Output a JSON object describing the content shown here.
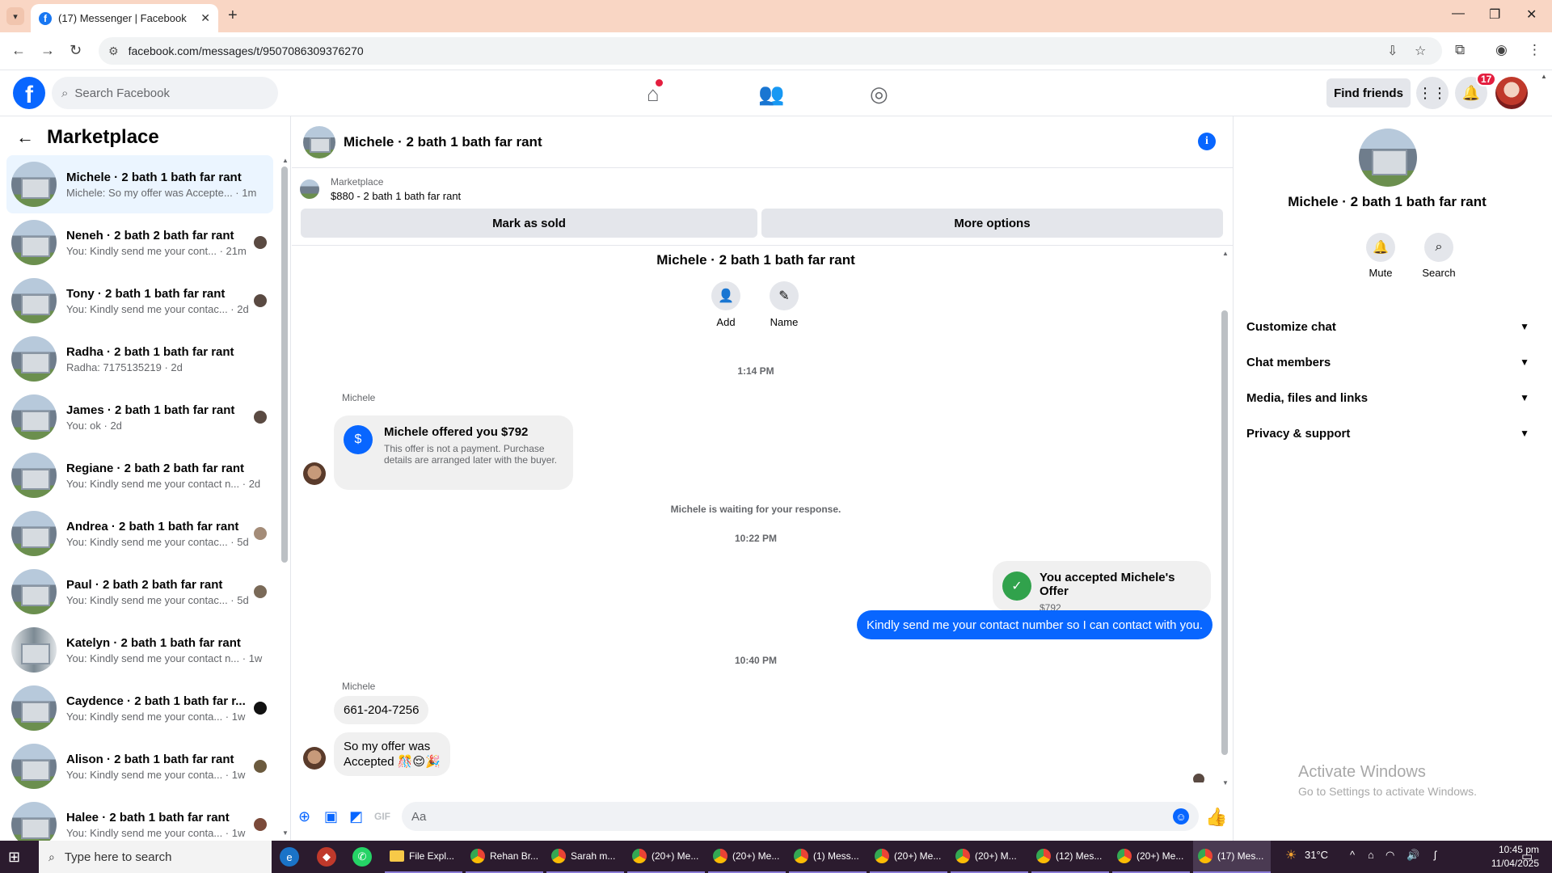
{
  "browser": {
    "tab_title": "(17) Messenger | Facebook",
    "url": "facebook.com/messages/t/9507086309376270"
  },
  "fb": {
    "search_placeholder": "Search Facebook",
    "find_friends": "Find friends",
    "notif_count": "17"
  },
  "sidebar": {
    "title": "Marketplace",
    "conversations": [
      {
        "name": "Michele · 2 bath 1 bath far rant",
        "preview": "Michele: So my offer was Accepte... · 1m",
        "active": true
      },
      {
        "name": "Neneh · 2 bath 2 bath far rant",
        "preview": "You: Kindly send me your cont... · 21m"
      },
      {
        "name": "Tony · 2 bath 1 bath far rant",
        "preview": "You: Kindly send me your contac... · 2d"
      },
      {
        "name": "Radha · 2 bath 1 bath far rant",
        "preview": "Radha: 7175135219 · 2d"
      },
      {
        "name": "James · 2 bath 1 bath far rant",
        "preview": "You: ok · 2d"
      },
      {
        "name": "Regiane · 2 bath 2 bath far rant",
        "preview": "You: Kindly send me your contact n... · 2d"
      },
      {
        "name": "Andrea · 2 bath 1 bath far rant",
        "preview": "You: Kindly send me your contac... · 5d"
      },
      {
        "name": "Paul · 2 bath 2 bath far rant",
        "preview": "You: Kindly send me your contac... · 5d"
      },
      {
        "name": "Katelyn · 2 bath 1 bath far rant",
        "preview": "You: Kindly send me your contact n... · 1w"
      },
      {
        "name": "Caydence · 2 bath 1 bath far r...",
        "preview": "You: Kindly send me your conta... · 1w"
      },
      {
        "name": "Alison · 2 bath 1 bath far rant",
        "preview": "You: Kindly send me your conta... · 1w"
      },
      {
        "name": "Halee · 2 bath 1 bath far rant",
        "preview": "You: Kindly send me your conta... · 1w"
      }
    ]
  },
  "chat": {
    "header_name": "Michele · 2 bath 1 bath far rant",
    "marketplace_label": "Marketplace",
    "listing": "$880 - 2 bath 1 bath far rant",
    "mark_sold": "Mark as sold",
    "more_options": "More options",
    "conv_title": "Michele · 2 bath 1 bath far rant",
    "add_label": "Add",
    "name_label": "Name",
    "ts1": "1:14 PM",
    "sender1": "Michele",
    "offer_title": "Michele offered you $792",
    "offer_desc": "This offer is not a payment. Purchase details are arranged later with the buyer.",
    "waiting": "Michele is waiting for your response.",
    "ts2": "10:22 PM",
    "accepted_title": "You accepted Michele's Offer",
    "accepted_amount": "$792",
    "out_msg": "Kindly send me your contact number so I can contact with you.",
    "ts3": "10:40 PM",
    "sender2": "Michele",
    "in_msg1": "661-204-7256",
    "in_msg2_line1": "So my offer was",
    "in_msg2_line2": "Accepted 🎊😌🎉",
    "composer_placeholder": "Aa"
  },
  "rpanel": {
    "name": "Michele · 2 bath 1 bath far rant",
    "mute": "Mute",
    "search": "Search",
    "sections": [
      "Customize chat",
      "Chat members",
      "Media, files and links",
      "Privacy & support"
    ],
    "activate_title": "Activate Windows",
    "activate_sub": "Go to Settings to activate Windows."
  },
  "taskbar": {
    "search_placeholder": "Type here to search",
    "apps": [
      "File Expl...",
      "Rehan Br...",
      "Sarah m...",
      "(20+) Me...",
      "(20+) Me...",
      "(1) Mess...",
      "(20+) Me...",
      "(20+) M...",
      "(12) Mes...",
      "(20+) Me...",
      "(17) Mes..."
    ],
    "temp": "31°C",
    "time": "10:45 pm",
    "date": "11/04/2025"
  },
  "colors": {
    "accent": "#0866ff",
    "accepted": "#31a24c",
    "tabbar": "#f9d6c4"
  }
}
